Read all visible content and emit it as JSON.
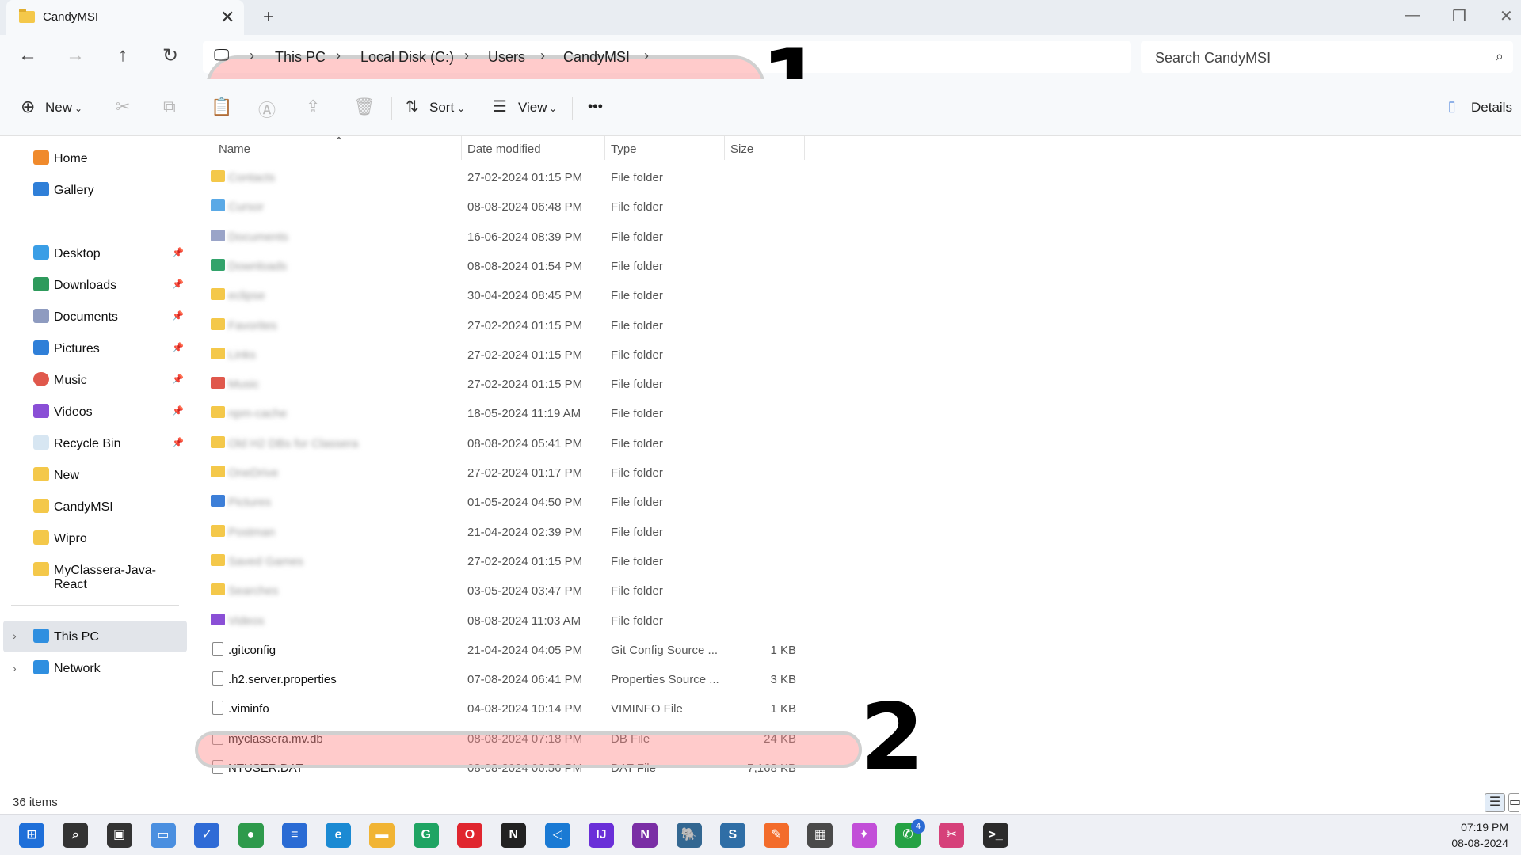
{
  "window": {
    "tab_title": "CandyMSI",
    "new_tab": "+",
    "minimize": "—",
    "restore": "❐",
    "close": "✕"
  },
  "nav": {
    "back": "←",
    "forward": "→",
    "up": "↑",
    "refresh": "↻"
  },
  "breadcrumb": [
    "This PC",
    "Local Disk (C:)",
    "Users",
    "CandyMSI"
  ],
  "search": {
    "placeholder": "Search CandyMSI"
  },
  "annotations": {
    "label1": "1",
    "label2": "2",
    "highlight_color": "#ff8c8c"
  },
  "toolbar": {
    "new_label": "New",
    "sort_label": "Sort",
    "view_label": "View",
    "more_label": "•••",
    "details_label": "Details"
  },
  "sidebar": {
    "top": [
      {
        "label": "Home",
        "icon": "home-icon"
      },
      {
        "label": "Gallery",
        "icon": "gallery-icon"
      }
    ],
    "quick": [
      {
        "label": "Desktop",
        "icon": "desktop-icon",
        "pinned": true
      },
      {
        "label": "Downloads",
        "icon": "download-icon",
        "pinned": true
      },
      {
        "label": "Documents",
        "icon": "documents-icon",
        "pinned": true
      },
      {
        "label": "Pictures",
        "icon": "pictures-icon",
        "pinned": true
      },
      {
        "label": "Music",
        "icon": "music-icon",
        "pinned": true
      },
      {
        "label": "Videos",
        "icon": "videos-icon",
        "pinned": true
      },
      {
        "label": "Recycle Bin",
        "icon": "recycle-bin-icon",
        "pinned": true
      },
      {
        "label": "New",
        "icon": "folder-icon",
        "pinned": false
      },
      {
        "label": "CandyMSI",
        "icon": "folder-icon",
        "pinned": false
      },
      {
        "label": "Wipro",
        "icon": "folder-icon",
        "pinned": false
      },
      {
        "label": "MyClassera-Java-React",
        "icon": "folder-icon",
        "pinned": false
      }
    ],
    "devices": [
      {
        "label": "This PC",
        "icon": "this-pc-icon",
        "selected": true
      },
      {
        "label": "Network",
        "icon": "network-icon",
        "selected": false
      }
    ],
    "pin_glyph": "📌",
    "expand_glyph": "›"
  },
  "columns": {
    "name": "Name",
    "date": "Date modified",
    "type": "Type",
    "size": "Size"
  },
  "files": [
    {
      "name": "Contacts",
      "date": "27-02-2024 01:15 PM",
      "type": "File folder",
      "size": "",
      "blurred": true,
      "icon": "folder-icon",
      "color": "#f4c84a"
    },
    {
      "name": "Cursor",
      "date": "08-08-2024 06:48 PM",
      "type": "File folder",
      "size": "",
      "blurred": true,
      "icon": "folder-icon",
      "color": "#5aa9e6"
    },
    {
      "name": "Documents",
      "date": "16-06-2024 08:39 PM",
      "type": "File folder",
      "size": "",
      "blurred": true,
      "icon": "documents-icon",
      "color": "#9aa4c8"
    },
    {
      "name": "Downloads",
      "date": "08-08-2024 01:54 PM",
      "type": "File folder",
      "size": "",
      "blurred": true,
      "icon": "download-icon",
      "color": "#33a36b"
    },
    {
      "name": "eclipse",
      "date": "30-04-2024 08:45 PM",
      "type": "File folder",
      "size": "",
      "blurred": true,
      "icon": "folder-icon",
      "color": "#f4c84a"
    },
    {
      "name": "Favorites",
      "date": "27-02-2024 01:15 PM",
      "type": "File folder",
      "size": "",
      "blurred": true,
      "icon": "folder-icon",
      "color": "#f4c84a"
    },
    {
      "name": "Links",
      "date": "27-02-2024 01:15 PM",
      "type": "File folder",
      "size": "",
      "blurred": true,
      "icon": "folder-icon",
      "color": "#f4c84a"
    },
    {
      "name": "Music",
      "date": "27-02-2024 01:15 PM",
      "type": "File folder",
      "size": "",
      "blurred": true,
      "icon": "music-icon",
      "color": "#e0584c"
    },
    {
      "name": "npm-cache",
      "date": "18-05-2024 11:19 AM",
      "type": "File folder",
      "size": "",
      "blurred": true,
      "icon": "folder-icon",
      "color": "#f4c84a"
    },
    {
      "name": "Old H2 DBs for Classera",
      "date": "08-08-2024 05:41 PM",
      "type": "File folder",
      "size": "",
      "blurred": true,
      "icon": "folder-icon",
      "color": "#f4c84a"
    },
    {
      "name": "OneDrive",
      "date": "27-02-2024 01:17 PM",
      "type": "File folder",
      "size": "",
      "blurred": true,
      "icon": "folder-icon",
      "color": "#f4c84a"
    },
    {
      "name": "Pictures",
      "date": "01-05-2024 04:50 PM",
      "type": "File folder",
      "size": "",
      "blurred": true,
      "icon": "pictures-icon",
      "color": "#3d7fd8"
    },
    {
      "name": "Postman",
      "date": "21-04-2024 02:39 PM",
      "type": "File folder",
      "size": "",
      "blurred": true,
      "icon": "folder-icon",
      "color": "#f4c84a"
    },
    {
      "name": "Saved Games",
      "date": "27-02-2024 01:15 PM",
      "type": "File folder",
      "size": "",
      "blurred": true,
      "icon": "folder-icon",
      "color": "#f4c84a"
    },
    {
      "name": "Searches",
      "date": "03-05-2024 03:47 PM",
      "type": "File folder",
      "size": "",
      "blurred": true,
      "icon": "folder-icon",
      "color": "#f4c84a"
    },
    {
      "name": "Videos",
      "date": "08-08-2024 11:03 AM",
      "type": "File folder",
      "size": "",
      "blurred": true,
      "icon": "videos-icon",
      "color": "#8a4fd6"
    },
    {
      "name": ".gitconfig",
      "date": "21-04-2024 04:05 PM",
      "type": "Git Config Source ...",
      "size": "1 KB",
      "blurred": false,
      "icon": "gear-file-icon",
      "color": "#ffffff"
    },
    {
      "name": ".h2.server.properties",
      "date": "07-08-2024 06:41 PM",
      "type": "Properties Source ...",
      "size": "3 KB",
      "blurred": false,
      "icon": "text-file-icon",
      "color": "#ffffff"
    },
    {
      "name": ".viminfo",
      "date": "04-08-2024 10:14 PM",
      "type": "VIMINFO File",
      "size": "1 KB",
      "blurred": false,
      "icon": "file-icon",
      "color": "#ffffff"
    },
    {
      "name": "myclassera.mv.db",
      "date": "08-08-2024 07:18 PM",
      "type": "DB File",
      "size": "24 KB",
      "blurred": false,
      "icon": "file-icon",
      "color": "#ffffff"
    },
    {
      "name": "NTUSER.DAT",
      "date": "08-08-2024 06:56 PM",
      "type": "DAT File",
      "size": "7,168 KB",
      "blurred": false,
      "icon": "file-icon",
      "color": "#ffffff"
    }
  ],
  "status": {
    "count": "36 items"
  },
  "taskbar": {
    "apps": [
      {
        "name": "start-icon",
        "glyph": "⊞",
        "color": "#1e6fd9"
      },
      {
        "name": "search-icon",
        "glyph": "⌕",
        "color": "#333333"
      },
      {
        "name": "task-view-icon",
        "glyph": "▣",
        "color": "#333333"
      },
      {
        "name": "widgets-icon",
        "glyph": "▭",
        "color": "#4a8fe0"
      },
      {
        "name": "todo-icon",
        "glyph": "✓",
        "color": "#2f6bd6"
      },
      {
        "name": "chrome-icon",
        "glyph": "●",
        "color": "#2e9a4c"
      },
      {
        "name": "notepad-icon",
        "glyph": "≡",
        "color": "#2a6bd4"
      },
      {
        "name": "edge-icon",
        "glyph": "e",
        "color": "#1b8ad3"
      },
      {
        "name": "file-explorer-icon",
        "glyph": "▬",
        "color": "#f1b434"
      },
      {
        "name": "chrome-alt-icon",
        "glyph": "G",
        "color": "#1fa463"
      },
      {
        "name": "opera-icon",
        "glyph": "O",
        "color": "#e0262f"
      },
      {
        "name": "notion-icon",
        "glyph": "N",
        "color": "#222222"
      },
      {
        "name": "vscode-icon",
        "glyph": "◁",
        "color": "#1a7ad4"
      },
      {
        "name": "intellij-icon",
        "glyph": "IJ",
        "color": "#6a2fd8"
      },
      {
        "name": "onenote-icon",
        "glyph": "N",
        "color": "#7a2ea5"
      },
      {
        "name": "postgres-icon",
        "glyph": "🐘",
        "color": "#336791"
      },
      {
        "name": "sql-icon",
        "glyph": "S",
        "color": "#2f6ea6"
      },
      {
        "name": "postman-icon",
        "glyph": "✎",
        "color": "#f36c2b"
      },
      {
        "name": "calculator-icon",
        "glyph": "▦",
        "color": "#4a4a4a"
      },
      {
        "name": "paint-icon",
        "glyph": "✦",
        "color": "#c24fd8"
      },
      {
        "name": "whatsapp-icon",
        "glyph": "✆",
        "color": "#25a244"
      },
      {
        "name": "snipping-tool-icon",
        "glyph": "✂",
        "color": "#d6417a"
      },
      {
        "name": "terminal-icon",
        "glyph": ">_",
        "color": "#2b2b2b"
      }
    ],
    "whatsapp_badge": "4",
    "time": "07:19 PM",
    "date": "08-08-2024"
  }
}
